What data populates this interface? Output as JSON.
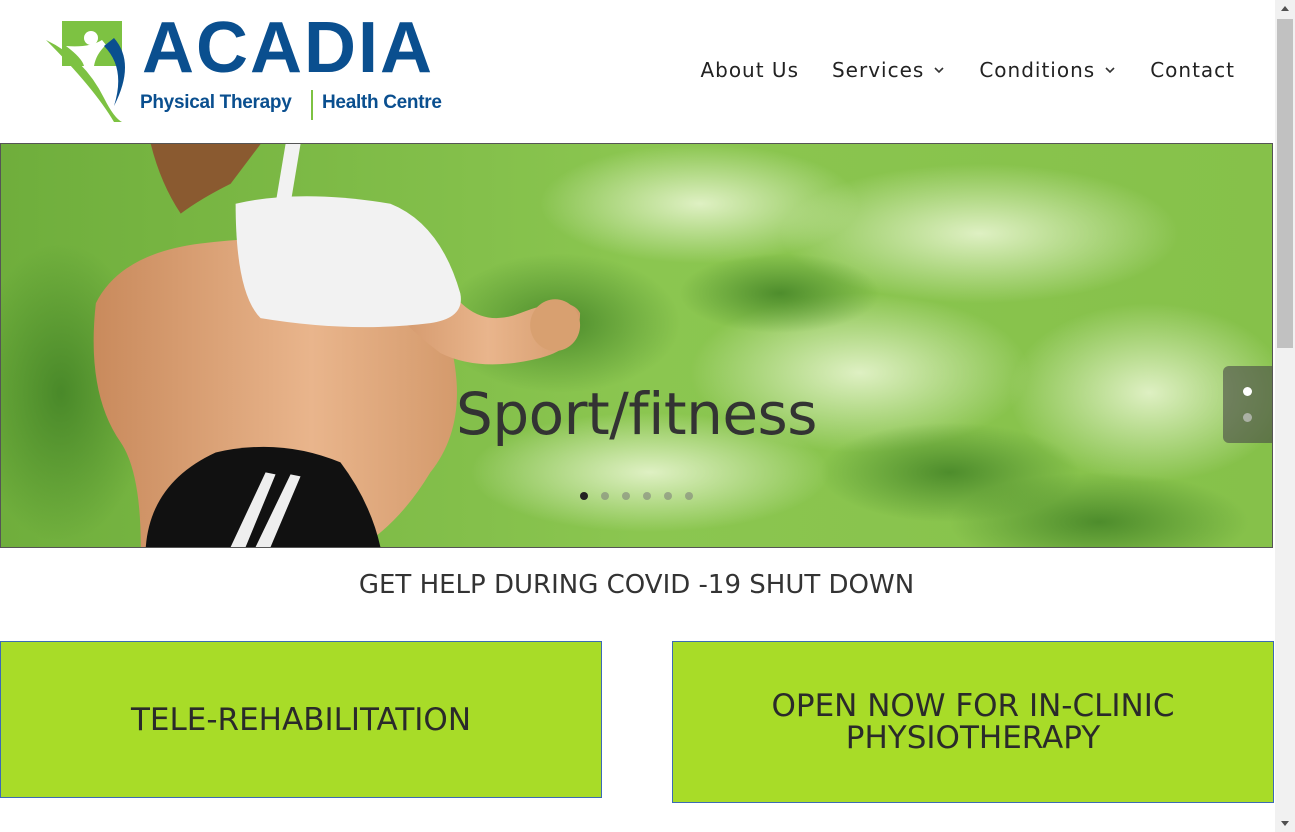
{
  "brand": {
    "name": "ACADIA",
    "sub_left": "Physical Therapy",
    "sub_right": "Health Centre",
    "colors": {
      "blue": "#0a4f8f",
      "green": "#7dc242"
    }
  },
  "nav": {
    "items": [
      {
        "label": "About Us",
        "has_dropdown": false
      },
      {
        "label": "Services",
        "has_dropdown": true
      },
      {
        "label": "Conditions",
        "has_dropdown": true
      },
      {
        "label": "Contact",
        "has_dropdown": false
      }
    ],
    "dropdown_icon": "chevron-down-icon"
  },
  "hero": {
    "slide_title": "Sport/fitness",
    "slide_count": 6,
    "active_slide": 1,
    "side_nav_count": 2,
    "side_nav_active": 1
  },
  "covid": {
    "heading": "GET HELP DURING COVID -19 SHUT DOWN"
  },
  "cta": {
    "left_label": "TELE-REHABILITATION",
    "right_label": "OPEN NOW FOR IN-CLINIC PHYSIOTHERAPY",
    "color": "#a8dc28"
  }
}
